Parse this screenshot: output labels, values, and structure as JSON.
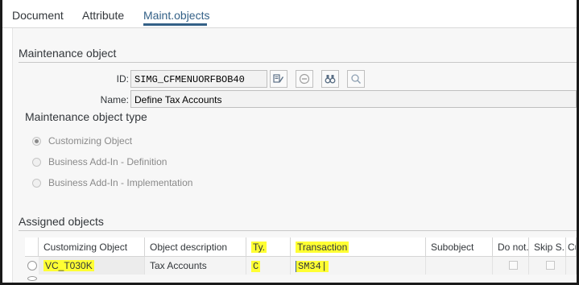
{
  "tabs": [
    {
      "label": "Document"
    },
    {
      "label": "Attribute"
    },
    {
      "label": "Maint.objects"
    }
  ],
  "maintenance_object": {
    "title": "Maintenance object",
    "id_label": "ID:",
    "id_value": "SIMG_CFMENUORFBOB40",
    "name_label": "Name:",
    "name_value": "Define Tax Accounts"
  },
  "object_type": {
    "title": "Maintenance object type",
    "options": [
      {
        "label": "Customizing Object",
        "selected": true
      },
      {
        "label": "Business Add-In - Definition",
        "selected": false
      },
      {
        "label": "Business Add-In - Implementation",
        "selected": false
      }
    ]
  },
  "assigned": {
    "title": "Assigned objects",
    "columns": [
      "Customizing Object",
      "Object description",
      "Ty.",
      "Transaction",
      "Subobject",
      "Do not...",
      "Skip S...",
      "Cu"
    ],
    "rows": [
      {
        "customizing_object": "VC_T030K",
        "description": "Tax Accounts",
        "type": "C",
        "transaction": "SM34"
      }
    ]
  },
  "icons": [
    "display-change-icon",
    "minus-circle-icon",
    "binoculars-icon",
    "search-icon"
  ],
  "colors": {
    "active_tab": "#346187",
    "highlight": "#ffff33"
  }
}
